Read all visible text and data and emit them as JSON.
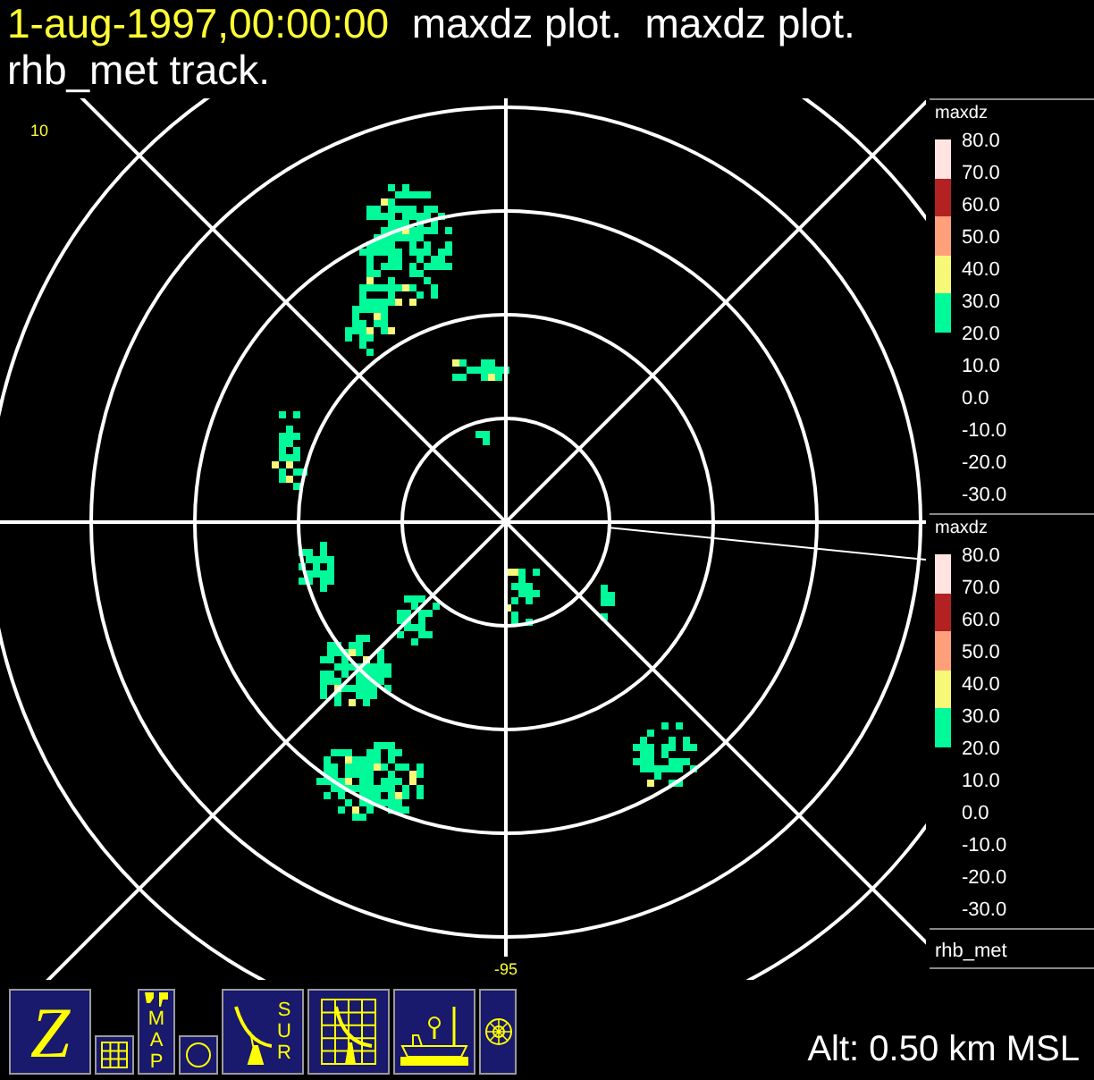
{
  "title": {
    "timestamp": "1-aug-1997,00:00:00",
    "text": "maxdz plot.  maxdz plot.",
    "subtitle": "rhb_met track."
  },
  "plot": {
    "corner_label": "10",
    "bottom_label": "-95"
  },
  "legends": [
    {
      "title": "maxdz",
      "labels": [
        "80.0",
        "70.0",
        "60.0",
        "50.0",
        "40.0",
        "30.0",
        "20.0",
        "10.0",
        "0.0",
        "-10.0",
        "-20.0",
        "-30.0"
      ],
      "bands": [
        {
          "color": "#ffe4e1"
        },
        {
          "color": "#b22222"
        },
        {
          "color": "#ffa07a"
        },
        {
          "color": "#f8f878"
        },
        {
          "color": "#00fa9a"
        }
      ]
    },
    {
      "title": "maxdz",
      "labels": [
        "80.0",
        "70.0",
        "60.0",
        "50.0",
        "40.0",
        "30.0",
        "20.0",
        "10.0",
        "0.0",
        "-10.0",
        "-20.0",
        "-30.0"
      ],
      "bands": [
        {
          "color": "#ffe4e1"
        },
        {
          "color": "#b22222"
        },
        {
          "color": "#ffa07a"
        },
        {
          "color": "#f8f878"
        },
        {
          "color": "#00fa9a"
        }
      ]
    }
  ],
  "platform_label": "rhb_met",
  "toolbar": [
    {
      "kind": "letter",
      "label": "Z"
    },
    {
      "kind": "grid"
    },
    {
      "kind": "map",
      "label": "MAP"
    },
    {
      "kind": "circle"
    },
    {
      "kind": "dish",
      "label": "SUR"
    },
    {
      "kind": "grid-dish"
    },
    {
      "kind": "ship"
    },
    {
      "kind": "wheel"
    }
  ],
  "altitude": "Alt: 0.50 km MSL"
}
